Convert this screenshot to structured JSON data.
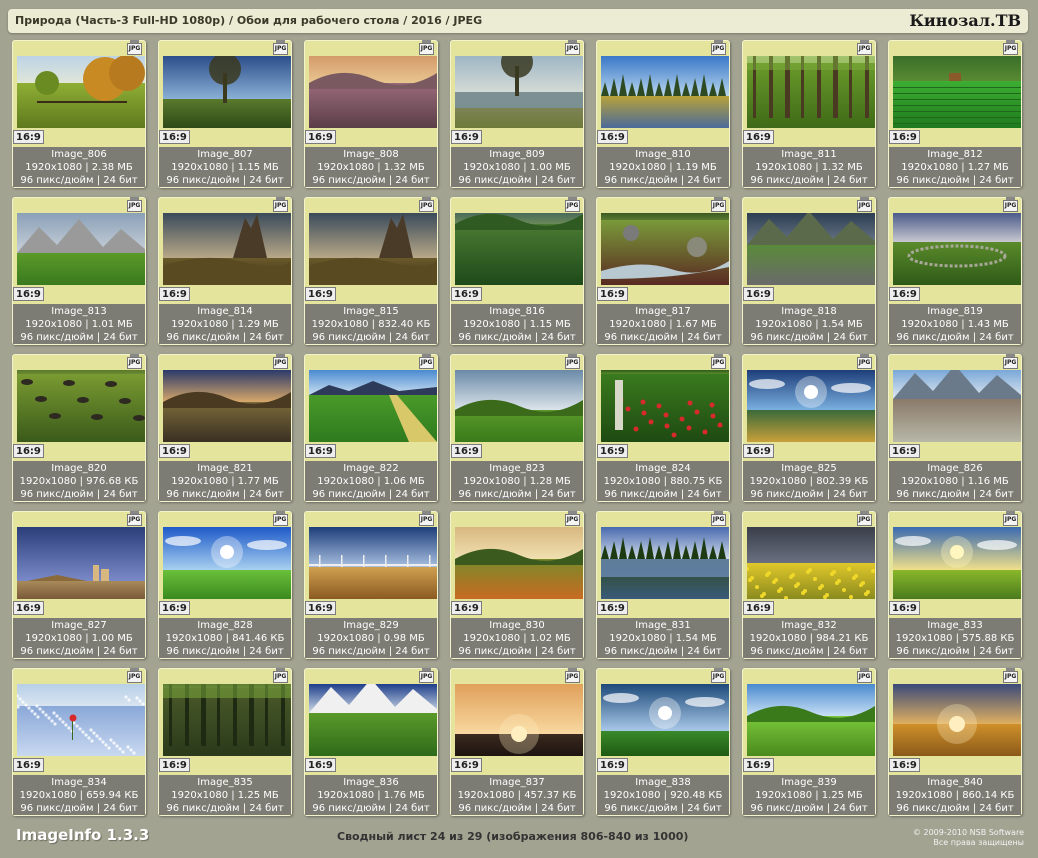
{
  "header": {
    "path": "Природа (Часть-3 Full-HD 1080p) / Обои для рабочего стола / 2016 / JPEG",
    "brand": "Кинозал.ТВ"
  },
  "tile_common": {
    "ratio": "16:9",
    "file_icon": "JPG",
    "icon_name": "jpg-file-icon"
  },
  "tiles": [
    {
      "name": "Image_806",
      "info": "1920x1080 | 2.38 МБ",
      "meta": "96 пикс/дюйм | 24 бит",
      "scene": "autumn-trees-meadow"
    },
    {
      "name": "Image_807",
      "info": "1920x1080 | 1.15 МБ",
      "meta": "96 пикс/дюйм | 24 бит",
      "scene": "tree-by-fence-sunset"
    },
    {
      "name": "Image_808",
      "info": "1920x1080 | 1.32 МБ",
      "meta": "96 пикс/дюйм | 24 бит",
      "scene": "heather-sunset-field"
    },
    {
      "name": "Image_809",
      "info": "1920x1080 | 1.00 МБ",
      "meta": "96 пикс/дюйм | 24 бит",
      "scene": "lake-with-tree"
    },
    {
      "name": "Image_810",
      "info": "1920x1080 | 1.19 МБ",
      "meta": "96 пикс/дюйм | 24 бит",
      "scene": "marsh-blue-sky"
    },
    {
      "name": "Image_811",
      "info": "1920x1080 | 1.32 МБ",
      "meta": "96 пикс/дюйм | 24 бит",
      "scene": "green-forest"
    },
    {
      "name": "Image_812",
      "info": "1920x1080 | 1.27 МБ",
      "meta": "96 пикс/дюйм | 24 бит",
      "scene": "rice-field-hut"
    },
    {
      "name": "Image_813",
      "info": "1920x1080 | 1.01 МБ",
      "meta": "96 пикс/дюйм | 24 бит",
      "scene": "rocky-mountains-meadow"
    },
    {
      "name": "Image_814",
      "info": "1920x1080 | 1.29 МБ",
      "meta": "96 пикс/дюйм | 24 бит",
      "scene": "rock-spire-hdr"
    },
    {
      "name": "Image_815",
      "info": "1920x1080 | 832.40 КБ",
      "meta": "96 пикс/дюйм | 24 бит",
      "scene": "rock-spire-hdr"
    },
    {
      "name": "Image_816",
      "info": "1920x1080 | 1.15 МБ",
      "meta": "96 пикс/дюйм | 24 бит",
      "scene": "green-valley"
    },
    {
      "name": "Image_817",
      "info": "1920x1080 | 1.67 МБ",
      "meta": "96 пикс/дюйм | 24 бит",
      "scene": "mossy-stream"
    },
    {
      "name": "Image_818",
      "info": "1920x1080 | 1.54 МБ",
      "meta": "96 пикс/дюйм | 24 бит",
      "scene": "rocky-coast-cliffs"
    },
    {
      "name": "Image_819",
      "info": "1920x1080 | 1.43 МБ",
      "meta": "96 пикс/дюйм | 24 бит",
      "scene": "stone-circle"
    },
    {
      "name": "Image_820",
      "info": "1920x1080 | 976.68 КБ",
      "meta": "96 пикс/дюйм | 24 бит",
      "scene": "mossy-rocks"
    },
    {
      "name": "Image_821",
      "info": "1920x1080 | 1.77 МБ",
      "meta": "96 пикс/дюйм | 24 бит",
      "scene": "hills-sunset-hdr"
    },
    {
      "name": "Image_822",
      "info": "1920x1080 | 1.06 МБ",
      "meta": "96 пикс/дюйм | 24 бит",
      "scene": "field-path-mountains"
    },
    {
      "name": "Image_823",
      "info": "1920x1080 | 1.28 МБ",
      "meta": "96 пикс/дюйм | 24 бит",
      "scene": "green-hills-clouds"
    },
    {
      "name": "Image_824",
      "info": "1920x1080 | 880.75 КБ",
      "meta": "96 пикс/дюйм | 24 бит",
      "scene": "red-berries"
    },
    {
      "name": "Image_825",
      "info": "1920x1080 | 802.39 КБ",
      "meta": "96 пикс/дюйм | 24 бит",
      "scene": "sunburst-hills"
    },
    {
      "name": "Image_826",
      "info": "1920x1080 | 1.16 МБ",
      "meta": "96 пикс/дюйм | 24 бит",
      "scene": "mountain-valley"
    },
    {
      "name": "Image_827",
      "info": "1920x1080 | 1.00 МБ",
      "meta": "96 пикс/дюйм | 24 бит",
      "scene": "storm-sky-ruins"
    },
    {
      "name": "Image_828",
      "info": "1920x1080 | 841.46 КБ",
      "meta": "96 пикс/дюйм | 24 бит",
      "scene": "sun-green-field"
    },
    {
      "name": "Image_829",
      "info": "1920x1080 | 0.98 МБ",
      "meta": "96 пикс/дюйм | 24 бит",
      "scene": "wheat-field-bridge"
    },
    {
      "name": "Image_830",
      "info": "1920x1080 | 1.02 МБ",
      "meta": "96 пикс/дюйм | 24 бит",
      "scene": "mountain-hills-sunset"
    },
    {
      "name": "Image_831",
      "info": "1920x1080 | 1.54 МБ",
      "meta": "96 пикс/дюйм | 24 бит",
      "scene": "lake-reflection-forest"
    },
    {
      "name": "Image_832",
      "info": "1920x1080 | 984.21 КБ",
      "meta": "96 пикс/дюйм | 24 бит",
      "scene": "yellow-flowers-storm"
    },
    {
      "name": "Image_833",
      "info": "1920x1080 | 575.88 КБ",
      "meta": "96 пикс/дюйм | 24 бит",
      "scene": "sunrise-field"
    },
    {
      "name": "Image_834",
      "info": "1920x1080 | 659.94 КБ",
      "meta": "96 пикс/дюйм | 24 бит",
      "scene": "blue-flowers-poppy"
    },
    {
      "name": "Image_835",
      "info": "1920x1080 | 1.25 МБ",
      "meta": "96 пикс/дюйм | 24 бит",
      "scene": "dark-forest"
    },
    {
      "name": "Image_836",
      "info": "1920x1080 | 1.76 МБ",
      "meta": "96 пикс/дюйм | 24 бит",
      "scene": "alpine-valley"
    },
    {
      "name": "Image_837",
      "info": "1920x1080 | 457.37 КБ",
      "meta": "96 пикс/дюйм | 24 бит",
      "scene": "orange-sunset"
    },
    {
      "name": "Image_838",
      "info": "1920x1080 | 920.48 КБ",
      "meta": "96 пикс/дюйм | 24 бит",
      "scene": "green-field-sky"
    },
    {
      "name": "Image_839",
      "info": "1920x1080 | 1.25 МБ",
      "meta": "96 пикс/дюйм | 24 бит",
      "scene": "rolling-green-hills"
    },
    {
      "name": "Image_840",
      "info": "1920x1080 | 860.14 КБ",
      "meta": "96 пикс/дюйм | 24 бит",
      "scene": "golden-field-sunset"
    }
  ],
  "footer": {
    "app": "ImageInfo 1.3.3",
    "summary": "Сводный лист 24 из 29 (изображения 806-840 из 1000)",
    "copyright": "© 2009-2010 NSB Software",
    "rights": "Все права защищены"
  }
}
